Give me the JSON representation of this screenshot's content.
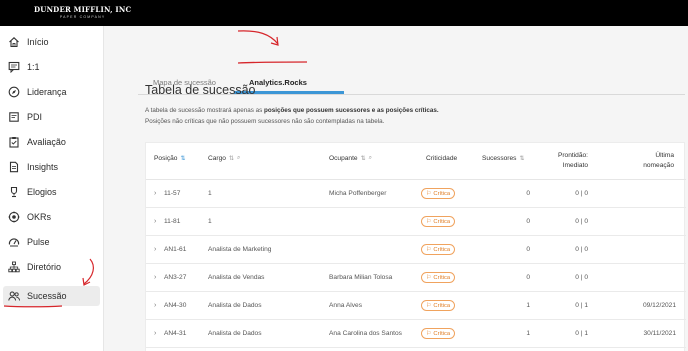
{
  "brand": {
    "name": "DUNDER MIFFLIN, INC",
    "tagline": "PAPER COMPANY"
  },
  "sidebar": {
    "items": [
      {
        "label": "Início",
        "icon": "home-icon"
      },
      {
        "label": "1:1",
        "icon": "chat-icon"
      },
      {
        "label": "Liderança",
        "icon": "compass-icon"
      },
      {
        "label": "PDI",
        "icon": "note-icon"
      },
      {
        "label": "Avaliação",
        "icon": "clipboard-icon"
      },
      {
        "label": "Insights",
        "icon": "document-icon"
      },
      {
        "label": "Elogios",
        "icon": "trophy-icon"
      },
      {
        "label": "OKRs",
        "icon": "target-icon"
      },
      {
        "label": "Pulse",
        "icon": "gauge-icon"
      },
      {
        "label": "Diretório",
        "icon": "org-chart-icon"
      },
      {
        "label": "Sucessão",
        "icon": "users-icon",
        "active": true
      }
    ]
  },
  "tabs": [
    {
      "label": "Mapa de sucessão",
      "active": false
    },
    {
      "label": "Analytics.Rocks",
      "active": true
    }
  ],
  "page": {
    "title": "Tabela de sucessão",
    "desc_line1_prefix": "A tabela de sucessão mostrará apenas as ",
    "desc_line1_bold": "posições que possuem sucessores e as posições críticas.",
    "desc_line2": "Posições não críticas que não possuem sucessores não são contempladas na tabela."
  },
  "table": {
    "headers": {
      "posicao": "Posição",
      "cargo": "Cargo",
      "ocupante": "Ocupante",
      "criticidade": "Criticidade",
      "sucessores": "Sucessores",
      "prontidao_l1": "Prontidão:",
      "prontidao_l2": "Imediato",
      "ultima_l1": "Última",
      "ultima_l2": "nomeação"
    },
    "rows": [
      {
        "posicao": "11-57",
        "cargo": "1",
        "ocupante": "Micha Poffenberger",
        "criticidade": "Crítica",
        "sucessores": "0",
        "prontidao": "0 | 0",
        "ultima": ""
      },
      {
        "posicao": "11-81",
        "cargo": "1",
        "ocupante": "",
        "criticidade": "Crítica",
        "sucessores": "0",
        "prontidao": "0 | 0",
        "ultima": ""
      },
      {
        "posicao": "AN1-61",
        "cargo": "Analista de Marketing",
        "ocupante": "",
        "criticidade": "Crítica",
        "sucessores": "0",
        "prontidao": "0 | 0",
        "ultima": ""
      },
      {
        "posicao": "AN3-27",
        "cargo": "Analista de Vendas",
        "ocupante": "Barbara Milian Tolosa",
        "criticidade": "Crítica",
        "sucessores": "0",
        "prontidao": "0 | 0",
        "ultima": ""
      },
      {
        "posicao": "AN4-30",
        "cargo": "Analista de Dados",
        "ocupante": "Anna Alves",
        "criticidade": "Crítica",
        "sucessores": "1",
        "prontidao": "0 | 1",
        "ultima": "09/12/2021"
      },
      {
        "posicao": "AN4-31",
        "cargo": "Analista de Dados",
        "ocupante": "Ana Carolina dos Santos",
        "criticidade": "Crítica",
        "sucessores": "1",
        "prontidao": "0 | 1",
        "ultima": "30/11/2021"
      }
    ]
  },
  "colors": {
    "accent_blue": "#3c96d6",
    "critical_orange": "#e07b20",
    "annotation_red": "#d6262b"
  }
}
